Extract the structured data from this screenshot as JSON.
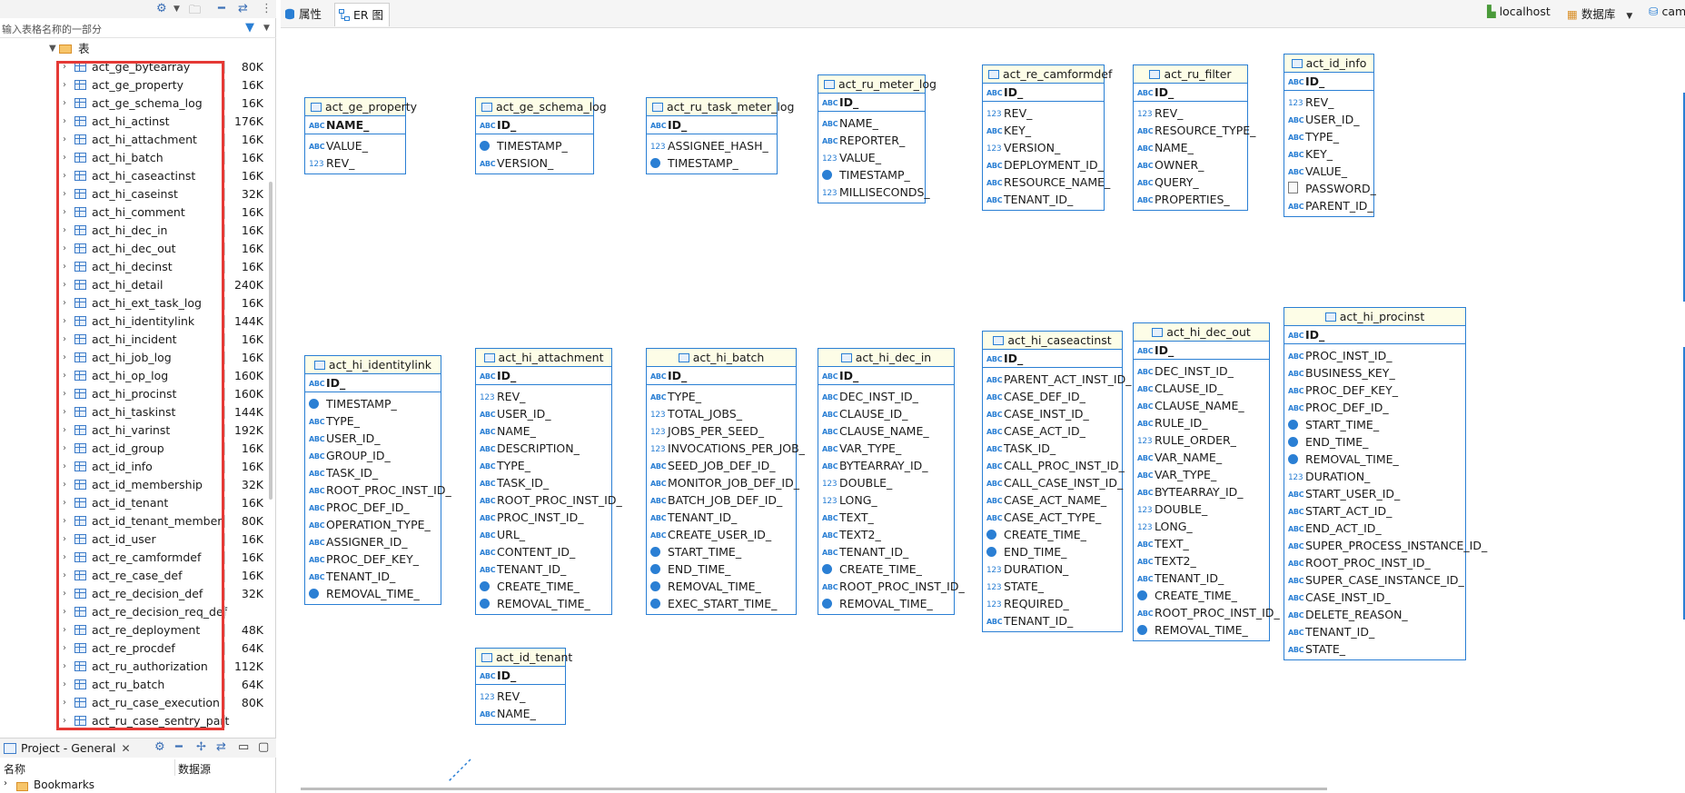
{
  "left_panel": {
    "filter_placeholder": "输入表格名称的一部分",
    "group_label": "表",
    "tables": [
      {
        "name": "act_ge_bytearray",
        "size": "80K"
      },
      {
        "name": "act_ge_property",
        "size": "16K"
      },
      {
        "name": "act_ge_schema_log",
        "size": "16K"
      },
      {
        "name": "act_hi_actinst",
        "size": "176K"
      },
      {
        "name": "act_hi_attachment",
        "size": "16K"
      },
      {
        "name": "act_hi_batch",
        "size": "16K"
      },
      {
        "name": "act_hi_caseactinst",
        "size": "16K"
      },
      {
        "name": "act_hi_caseinst",
        "size": "32K"
      },
      {
        "name": "act_hi_comment",
        "size": "16K"
      },
      {
        "name": "act_hi_dec_in",
        "size": "16K"
      },
      {
        "name": "act_hi_dec_out",
        "size": "16K"
      },
      {
        "name": "act_hi_decinst",
        "size": "16K"
      },
      {
        "name": "act_hi_detail",
        "size": "240K"
      },
      {
        "name": "act_hi_ext_task_log",
        "size": "16K"
      },
      {
        "name": "act_hi_identitylink",
        "size": "144K"
      },
      {
        "name": "act_hi_incident",
        "size": "16K"
      },
      {
        "name": "act_hi_job_log",
        "size": "16K"
      },
      {
        "name": "act_hi_op_log",
        "size": "160K"
      },
      {
        "name": "act_hi_procinst",
        "size": "160K"
      },
      {
        "name": "act_hi_taskinst",
        "size": "144K"
      },
      {
        "name": "act_hi_varinst",
        "size": "192K"
      },
      {
        "name": "act_id_group",
        "size": "16K"
      },
      {
        "name": "act_id_info",
        "size": "16K"
      },
      {
        "name": "act_id_membership",
        "size": "32K"
      },
      {
        "name": "act_id_tenant",
        "size": "16K"
      },
      {
        "name": "act_id_tenant_member",
        "size": "80K"
      },
      {
        "name": "act_id_user",
        "size": "16K"
      },
      {
        "name": "act_re_camformdef",
        "size": "16K"
      },
      {
        "name": "act_re_case_def",
        "size": "16K"
      },
      {
        "name": "act_re_decision_def",
        "size": "32K"
      },
      {
        "name": "act_re_decision_req_def",
        "size": ""
      },
      {
        "name": "act_re_deployment",
        "size": "48K"
      },
      {
        "name": "act_re_procdef",
        "size": "64K"
      },
      {
        "name": "act_ru_authorization",
        "size": "112K"
      },
      {
        "name": "act_ru_batch",
        "size": "64K"
      },
      {
        "name": "act_ru_case_execution",
        "size": "80K"
      },
      {
        "name": "act_ru_case_sentry_part",
        "size": ""
      }
    ],
    "project_tab": "Project - General",
    "project_columns": {
      "name": "名称",
      "datasource": "数据源"
    },
    "bookmarks_label": "Bookmarks"
  },
  "editor": {
    "tab_properties": "属性",
    "tab_er": "ER 图",
    "connection": "localhost",
    "database_label": "数据库",
    "schema_label": "cam"
  },
  "entities": [
    {
      "name": "act_ge_property",
      "pk": "NAME_",
      "cols": [
        {
          "t": "abc",
          "n": "VALUE_"
        },
        {
          "t": "num",
          "n": "REV_"
        }
      ]
    },
    {
      "name": "act_ge_schema_log",
      "pk": "ID_",
      "cols": [
        {
          "t": "ts",
          "n": "TIMESTAMP_"
        },
        {
          "t": "abc",
          "n": "VERSION_"
        }
      ]
    },
    {
      "name": "act_ru_task_meter_log",
      "pk": "ID_",
      "cols": [
        {
          "t": "num",
          "n": "ASSIGNEE_HASH_"
        },
        {
          "t": "ts",
          "n": "TIMESTAMP_"
        }
      ]
    },
    {
      "name": "act_ru_meter_log",
      "pk": "ID_",
      "cols": [
        {
          "t": "abc",
          "n": "NAME_"
        },
        {
          "t": "abc",
          "n": "REPORTER_"
        },
        {
          "t": "num",
          "n": "VALUE_"
        },
        {
          "t": "ts",
          "n": "TIMESTAMP_"
        },
        {
          "t": "num",
          "n": "MILLISECONDS_"
        }
      ]
    },
    {
      "name": "act_re_camformdef",
      "pk": "ID_",
      "cols": [
        {
          "t": "num",
          "n": "REV_"
        },
        {
          "t": "abc",
          "n": "KEY_"
        },
        {
          "t": "num",
          "n": "VERSION_"
        },
        {
          "t": "abc",
          "n": "DEPLOYMENT_ID_"
        },
        {
          "t": "abc",
          "n": "RESOURCE_NAME_"
        },
        {
          "t": "abc",
          "n": "TENANT_ID_"
        }
      ]
    },
    {
      "name": "act_ru_filter",
      "pk": "ID_",
      "cols": [
        {
          "t": "num",
          "n": "REV_"
        },
        {
          "t": "abc",
          "n": "RESOURCE_TYPE_"
        },
        {
          "t": "abc",
          "n": "NAME_"
        },
        {
          "t": "abc",
          "n": "OWNER_"
        },
        {
          "t": "abc",
          "n": "QUERY_"
        },
        {
          "t": "abc",
          "n": "PROPERTIES_"
        }
      ]
    },
    {
      "name": "act_id_info",
      "pk": "ID_",
      "cols": [
        {
          "t": "num",
          "n": "REV_"
        },
        {
          "t": "abc",
          "n": "USER_ID_"
        },
        {
          "t": "abc",
          "n": "TYPE_"
        },
        {
          "t": "abc",
          "n": "KEY_"
        },
        {
          "t": "abc",
          "n": "VALUE_"
        },
        {
          "t": "doc",
          "n": "PASSWORD_"
        },
        {
          "t": "abc",
          "n": "PARENT_ID_"
        }
      ]
    },
    {
      "name": "act_hi_identitylink",
      "pk": "ID_",
      "cols": [
        {
          "t": "ts",
          "n": "TIMESTAMP_"
        },
        {
          "t": "abc",
          "n": "TYPE_"
        },
        {
          "t": "abc",
          "n": "USER_ID_"
        },
        {
          "t": "key",
          "n": "GROUP_ID_"
        },
        {
          "t": "key",
          "n": "TASK_ID_"
        },
        {
          "t": "key",
          "n": "ROOT_PROC_INST_ID_"
        },
        {
          "t": "abc",
          "n": "PROC_DEF_ID_"
        },
        {
          "t": "abc",
          "n": "OPERATION_TYPE_"
        },
        {
          "t": "abc",
          "n": "ASSIGNER_ID_"
        },
        {
          "t": "key",
          "n": "PROC_DEF_KEY_"
        },
        {
          "t": "abc",
          "n": "TENANT_ID_"
        },
        {
          "t": "ts",
          "n": "REMOVAL_TIME_"
        }
      ]
    },
    {
      "name": "act_hi_attachment",
      "pk": "ID_",
      "cols": [
        {
          "t": "num",
          "n": "REV_"
        },
        {
          "t": "abc",
          "n": "USER_ID_"
        },
        {
          "t": "abc",
          "n": "NAME_"
        },
        {
          "t": "abc",
          "n": "DESCRIPTION_"
        },
        {
          "t": "abc",
          "n": "TYPE_"
        },
        {
          "t": "key",
          "n": "TASK_ID_"
        },
        {
          "t": "key",
          "n": "ROOT_PROC_INST_ID_"
        },
        {
          "t": "key",
          "n": "PROC_INST_ID_"
        },
        {
          "t": "abc",
          "n": "URL_"
        },
        {
          "t": "key",
          "n": "CONTENT_ID_"
        },
        {
          "t": "abc",
          "n": "TENANT_ID_"
        },
        {
          "t": "ts",
          "n": "CREATE_TIME_"
        },
        {
          "t": "ts",
          "n": "REMOVAL_TIME_"
        }
      ]
    },
    {
      "name": "act_hi_batch",
      "pk": "ID_",
      "cols": [
        {
          "t": "abc",
          "n": "TYPE_"
        },
        {
          "t": "num",
          "n": "TOTAL_JOBS_"
        },
        {
          "t": "num",
          "n": "JOBS_PER_SEED_"
        },
        {
          "t": "num",
          "n": "INVOCATIONS_PER_JOB_"
        },
        {
          "t": "abc",
          "n": "SEED_JOB_DEF_ID_"
        },
        {
          "t": "abc",
          "n": "MONITOR_JOB_DEF_ID_"
        },
        {
          "t": "abc",
          "n": "BATCH_JOB_DEF_ID_"
        },
        {
          "t": "abc",
          "n": "TENANT_ID_"
        },
        {
          "t": "abc",
          "n": "CREATE_USER_ID_"
        },
        {
          "t": "ts",
          "n": "START_TIME_"
        },
        {
          "t": "ts",
          "n": "END_TIME_"
        },
        {
          "t": "ts",
          "n": "REMOVAL_TIME_"
        },
        {
          "t": "ts",
          "n": "EXEC_START_TIME_"
        }
      ]
    },
    {
      "name": "act_hi_dec_in",
      "pk": "ID_",
      "cols": [
        {
          "t": "key",
          "n": "DEC_INST_ID_"
        },
        {
          "t": "abc",
          "n": "CLAUSE_ID_"
        },
        {
          "t": "abc",
          "n": "CLAUSE_NAME_"
        },
        {
          "t": "abc",
          "n": "VAR_TYPE_"
        },
        {
          "t": "abc",
          "n": "BYTEARRAY_ID_"
        },
        {
          "t": "num",
          "n": "DOUBLE_"
        },
        {
          "t": "num",
          "n": "LONG_"
        },
        {
          "t": "abc",
          "n": "TEXT_"
        },
        {
          "t": "abc",
          "n": "TEXT2_"
        },
        {
          "t": "abc",
          "n": "TENANT_ID_"
        },
        {
          "t": "ts",
          "n": "CREATE_TIME_"
        },
        {
          "t": "key",
          "n": "ROOT_PROC_INST_ID_"
        },
        {
          "t": "ts",
          "n": "REMOVAL_TIME_"
        }
      ]
    },
    {
      "name": "act_hi_caseactinst",
      "pk": "ID_",
      "cols": [
        {
          "t": "abc",
          "n": "PARENT_ACT_INST_ID_"
        },
        {
          "t": "abc",
          "n": "CASE_DEF_ID_"
        },
        {
          "t": "key",
          "n": "CASE_INST_ID_"
        },
        {
          "t": "key",
          "n": "CASE_ACT_ID_"
        },
        {
          "t": "abc",
          "n": "TASK_ID_"
        },
        {
          "t": "abc",
          "n": "CALL_PROC_INST_ID_"
        },
        {
          "t": "abc",
          "n": "CALL_CASE_INST_ID_"
        },
        {
          "t": "abc",
          "n": "CASE_ACT_NAME_"
        },
        {
          "t": "abc",
          "n": "CASE_ACT_TYPE_"
        },
        {
          "t": "ts",
          "n": "CREATE_TIME_"
        },
        {
          "t": "ts",
          "n": "END_TIME_"
        },
        {
          "t": "num",
          "n": "DURATION_"
        },
        {
          "t": "num",
          "n": "STATE_"
        },
        {
          "t": "num",
          "n": "REQUIRED_"
        },
        {
          "t": "key",
          "n": "TENANT_ID_"
        }
      ]
    },
    {
      "name": "act_hi_dec_out",
      "pk": "ID_",
      "cols": [
        {
          "t": "key",
          "n": "DEC_INST_ID_"
        },
        {
          "t": "abc",
          "n": "CLAUSE_ID_"
        },
        {
          "t": "abc",
          "n": "CLAUSE_NAME_"
        },
        {
          "t": "abc",
          "n": "RULE_ID_"
        },
        {
          "t": "num",
          "n": "RULE_ORDER_"
        },
        {
          "t": "abc",
          "n": "VAR_NAME_"
        },
        {
          "t": "abc",
          "n": "VAR_TYPE_"
        },
        {
          "t": "abc",
          "n": "BYTEARRAY_ID_"
        },
        {
          "t": "num",
          "n": "DOUBLE_"
        },
        {
          "t": "num",
          "n": "LONG_"
        },
        {
          "t": "abc",
          "n": "TEXT_"
        },
        {
          "t": "abc",
          "n": "TEXT2_"
        },
        {
          "t": "abc",
          "n": "TENANT_ID_"
        },
        {
          "t": "ts",
          "n": "CREATE_TIME_"
        },
        {
          "t": "key",
          "n": "ROOT_PROC_INST_ID_"
        },
        {
          "t": "ts",
          "n": "REMOVAL_TIME_"
        }
      ]
    },
    {
      "name": "act_hi_procinst",
      "pk": "ID_",
      "cols": [
        {
          "t": "key",
          "n": "PROC_INST_ID_"
        },
        {
          "t": "key",
          "n": "BUSINESS_KEY_"
        },
        {
          "t": "key",
          "n": "PROC_DEF_KEY_"
        },
        {
          "t": "abc",
          "n": "PROC_DEF_ID_"
        },
        {
          "t": "ts",
          "n": "START_TIME_"
        },
        {
          "t": "ts",
          "n": "END_TIME_"
        },
        {
          "t": "ts",
          "n": "REMOVAL_TIME_"
        },
        {
          "t": "num",
          "n": "DURATION_"
        },
        {
          "t": "abc",
          "n": "START_USER_ID_"
        },
        {
          "t": "abc",
          "n": "START_ACT_ID_"
        },
        {
          "t": "abc",
          "n": "END_ACT_ID_"
        },
        {
          "t": "abc",
          "n": "SUPER_PROCESS_INSTANCE_ID_"
        },
        {
          "t": "key",
          "n": "ROOT_PROC_INST_ID_"
        },
        {
          "t": "abc",
          "n": "SUPER_CASE_INSTANCE_ID_"
        },
        {
          "t": "abc",
          "n": "CASE_INST_ID_"
        },
        {
          "t": "abc",
          "n": "DELETE_REASON_"
        },
        {
          "t": "abc",
          "n": "TENANT_ID_"
        },
        {
          "t": "abc",
          "n": "STATE_"
        }
      ]
    },
    {
      "name": "act_id_tenant",
      "pk": "ID_",
      "cols": [
        {
          "t": "num",
          "n": "REV_"
        },
        {
          "t": "abc",
          "n": "NAME_"
        }
      ]
    }
  ]
}
